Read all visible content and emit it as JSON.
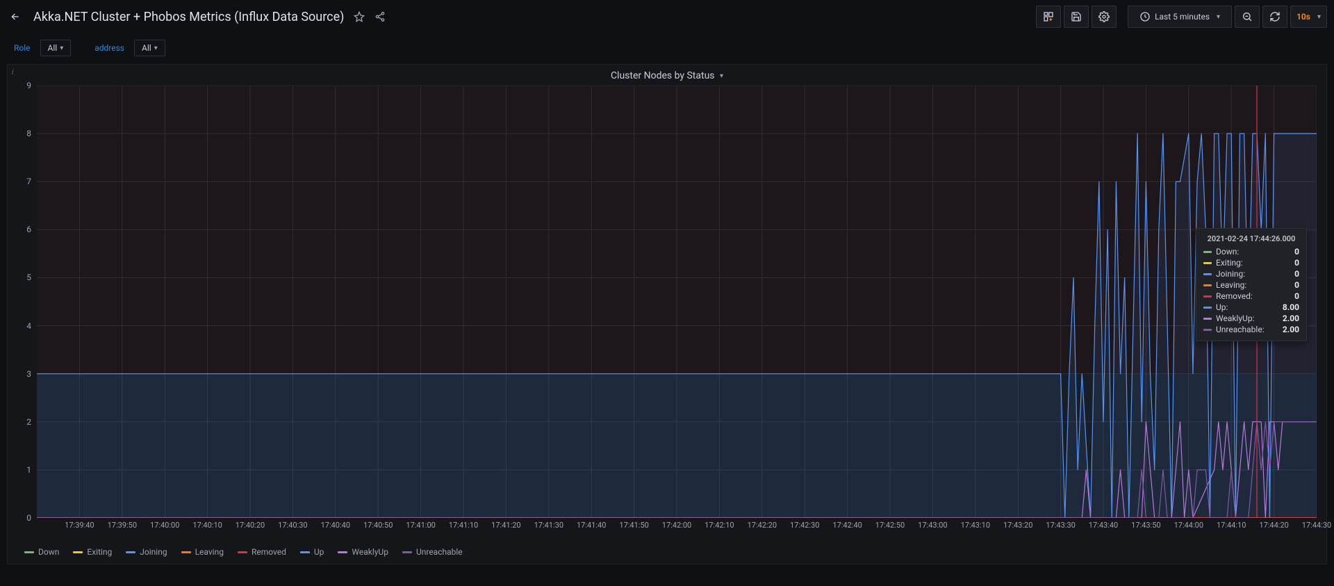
{
  "header": {
    "title": "Akka.NET Cluster + Phobos Metrics (Influx Data Source)",
    "time_range": "Last 5 minutes",
    "refresh": "10s"
  },
  "variables": {
    "role_label": "Role",
    "role_value": "All",
    "address_label": "address",
    "address_value": "All"
  },
  "panel": {
    "title": "Cluster Nodes by Status"
  },
  "tooltip": {
    "time": "2021-02-24 17:44:26.000",
    "rows": [
      {
        "name": "Down:",
        "value": "0",
        "color": "#73bf69"
      },
      {
        "name": "Exiting:",
        "value": "0",
        "color": "#f2cc0c"
      },
      {
        "name": "Joining:",
        "value": "0",
        "color": "#5794f2"
      },
      {
        "name": "Leaving:",
        "value": "0",
        "color": "#ff780a"
      },
      {
        "name": "Removed:",
        "value": "0",
        "color": "#e02f44"
      },
      {
        "name": "Up:",
        "value": "8.00",
        "color": "#5794f2"
      },
      {
        "name": "WeaklyUp:",
        "value": "2.00",
        "color": "#b877d9"
      },
      {
        "name": "Unreachable:",
        "value": "2.00",
        "color": "#8158a3"
      }
    ]
  },
  "chart_data": {
    "type": "line",
    "title": "Cluster Nodes by Status",
    "xlabel": "",
    "ylabel": "",
    "ylim": [
      0,
      9
    ],
    "y_ticks": [
      0,
      1,
      2,
      3,
      4,
      5,
      6,
      7,
      8,
      9
    ],
    "x_ticks": [
      "17:39:40",
      "17:39:50",
      "17:40:00",
      "17:40:10",
      "17:40:20",
      "17:40:30",
      "17:40:40",
      "17:40:50",
      "17:41:00",
      "17:41:10",
      "17:41:20",
      "17:41:30",
      "17:41:40",
      "17:41:50",
      "17:42:00",
      "17:42:10",
      "17:42:20",
      "17:42:30",
      "17:42:40",
      "17:42:50",
      "17:43:00",
      "17:43:10",
      "17:43:20",
      "17:43:30",
      "17:43:40",
      "17:43:50",
      "17:44:00",
      "17:44:10",
      "17:44:20",
      "17:44:30"
    ],
    "x_start_sec": 0,
    "x_end_sec": 300,
    "grid": true,
    "legend_position": "bottom-left",
    "cursor_x_sec": 286,
    "series": [
      {
        "name": "Down",
        "color": "#73bf69",
        "values": [
          [
            0,
            0
          ],
          [
            300,
            0
          ]
        ]
      },
      {
        "name": "Exiting",
        "color": "#f2cc0c",
        "values": [
          [
            0,
            0
          ],
          [
            300,
            0
          ]
        ]
      },
      {
        "name": "Joining",
        "color": "#5794f2",
        "values": [
          [
            0,
            0
          ],
          [
            300,
            0
          ]
        ]
      },
      {
        "name": "Leaving",
        "color": "#ff780a",
        "values": [
          [
            0,
            0
          ],
          [
            300,
            0
          ]
        ]
      },
      {
        "name": "Removed",
        "color": "#e02f44",
        "values": [
          [
            0,
            0
          ],
          [
            300,
            0
          ]
        ]
      },
      {
        "name": "Up",
        "color": "#5794f2",
        "values": [
          [
            0,
            3
          ],
          [
            233,
            3
          ],
          [
            236,
            3
          ],
          [
            238,
            3
          ],
          [
            240,
            3
          ],
          [
            241,
            0
          ],
          [
            242,
            3
          ],
          [
            243,
            5
          ],
          [
            244,
            1
          ],
          [
            245,
            3
          ],
          [
            247,
            0
          ],
          [
            248,
            4
          ],
          [
            249,
            7
          ],
          [
            250,
            2
          ],
          [
            251,
            6
          ],
          [
            252,
            0
          ],
          [
            253,
            7
          ],
          [
            254,
            3
          ],
          [
            255,
            5
          ],
          [
            256,
            0
          ],
          [
            258,
            8
          ],
          [
            259,
            2
          ],
          [
            260,
            7
          ],
          [
            261,
            3
          ],
          [
            262,
            1
          ],
          [
            263,
            6
          ],
          [
            264,
            8
          ],
          [
            265,
            4
          ],
          [
            266,
            0
          ],
          [
            267,
            7
          ],
          [
            268,
            7
          ],
          [
            270,
            8
          ],
          [
            271,
            3
          ],
          [
            272,
            7
          ],
          [
            273,
            8
          ],
          [
            274,
            6
          ],
          [
            275,
            0
          ],
          [
            276,
            8
          ],
          [
            277,
            8
          ],
          [
            278,
            5
          ],
          [
            279,
            8
          ],
          [
            280,
            8
          ],
          [
            281,
            0
          ],
          [
            282,
            8
          ],
          [
            283,
            8
          ],
          [
            284,
            4
          ],
          [
            285,
            8
          ],
          [
            286,
            8
          ],
          [
            287,
            6
          ],
          [
            288,
            8
          ],
          [
            289,
            0
          ],
          [
            290,
            8
          ],
          [
            300,
            8
          ]
        ]
      },
      {
        "name": "WeaklyUp",
        "color": "#b877d9",
        "values": [
          [
            0,
            0
          ],
          [
            245,
            0
          ],
          [
            246,
            1
          ],
          [
            247,
            0
          ],
          [
            253,
            0
          ],
          [
            254,
            1
          ],
          [
            255,
            0
          ],
          [
            259,
            0
          ],
          [
            260,
            2
          ],
          [
            261,
            1
          ],
          [
            262,
            0
          ],
          [
            266,
            0
          ],
          [
            267,
            1
          ],
          [
            268,
            2
          ],
          [
            269,
            0
          ],
          [
            270,
            1
          ],
          [
            271,
            0
          ],
          [
            276,
            1
          ],
          [
            277,
            2
          ],
          [
            278,
            1
          ],
          [
            279,
            2
          ],
          [
            280,
            1
          ],
          [
            281,
            0
          ],
          [
            283,
            2
          ],
          [
            284,
            1
          ],
          [
            285,
            2
          ],
          [
            286,
            2
          ],
          [
            287,
            2
          ],
          [
            288,
            0
          ],
          [
            289,
            2
          ],
          [
            290,
            2
          ],
          [
            291,
            1
          ],
          [
            292,
            2
          ],
          [
            300,
            2
          ]
        ]
      },
      {
        "name": "Unreachable",
        "color": "#8158a3",
        "values": [
          [
            0,
            0
          ],
          [
            258,
            0
          ],
          [
            259,
            1
          ],
          [
            260,
            0
          ],
          [
            263,
            0
          ],
          [
            264,
            1
          ],
          [
            265,
            0
          ],
          [
            271,
            0
          ],
          [
            272,
            1
          ],
          [
            273,
            1
          ],
          [
            274,
            1
          ],
          [
            275,
            0
          ],
          [
            279,
            0
          ],
          [
            280,
            1
          ],
          [
            281,
            0
          ],
          [
            284,
            0
          ],
          [
            285,
            1
          ],
          [
            286,
            2
          ],
          [
            287,
            1
          ],
          [
            288,
            2
          ],
          [
            289,
            1
          ],
          [
            290,
            2
          ],
          [
            300,
            2
          ]
        ]
      }
    ]
  }
}
